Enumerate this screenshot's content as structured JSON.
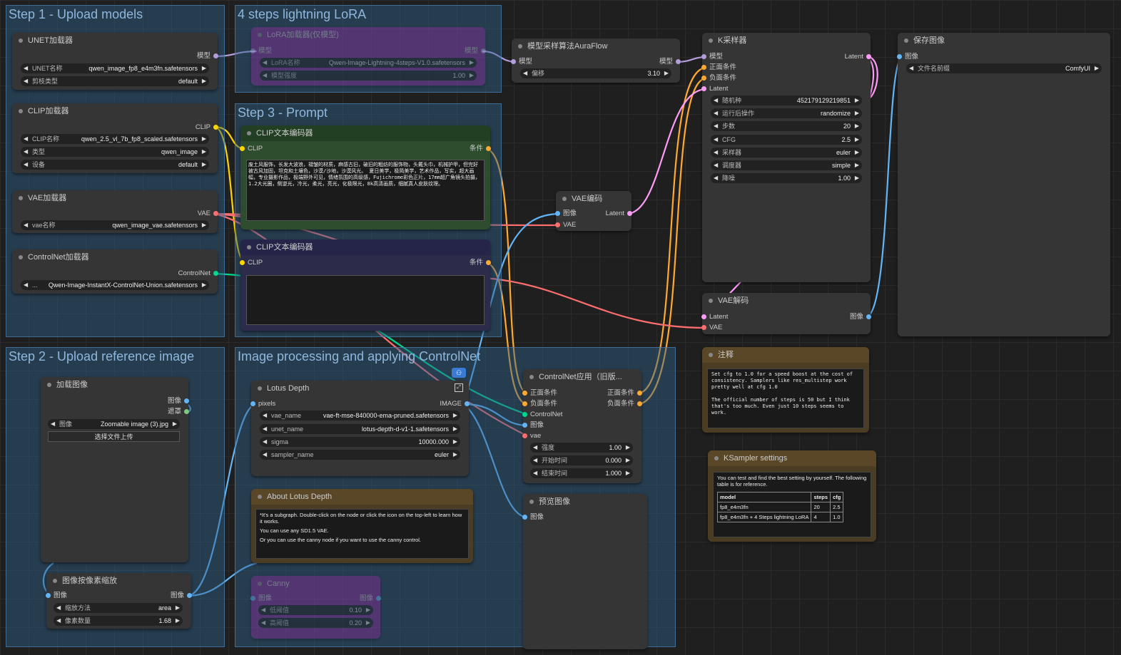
{
  "groups": {
    "g1": "Step 1 - Upload models",
    "g2": "4 steps lightning LoRA",
    "g3": "Step 3 - Prompt",
    "g4": "Step 2 - Upload reference image",
    "g5": "Image processing and applying ControlNet"
  },
  "unet": {
    "title": "UNET加载器",
    "out": "模型",
    "w1l": "UNET名称",
    "w1v": "qwen_image_fp8_e4m3fn.safetensors",
    "w2l": "剪枝类型",
    "w2v": "default"
  },
  "clip": {
    "title": "CLIP加载器",
    "out": "CLIP",
    "w1l": "CLIP名称",
    "w1v": "qwen_2.5_vl_7b_fp8_scaled.safetensors",
    "w2l": "类型",
    "w2v": "qwen_image",
    "w3l": "设备",
    "w3v": "default"
  },
  "vae": {
    "title": "VAE加载器",
    "out": "VAE",
    "w1l": "vae名称",
    "w1v": "qwen_image_vae.safetensors"
  },
  "cnl": {
    "title": "ControlNet加载器",
    "out": "ControlNet",
    "w1l": "...",
    "w1v": "Qwen-Image-InstantX-ControlNet-Union.safetensors"
  },
  "lora": {
    "title": "LoRA加载器(仅模型)",
    "in": "模型",
    "out": "模型",
    "w1l": "LoRA名称",
    "w1v": "Qwen-Image-Lightning-4steps-V1.0.safetensors",
    "w2l": "模型强度",
    "w2v": "1.00"
  },
  "aura": {
    "title": "模型采样算法AuraFlow",
    "in": "模型",
    "out": "模型",
    "w1l": "偏移",
    "w1v": "3.10"
  },
  "pos": {
    "title": "CLIP文本编码器",
    "in": "CLIP",
    "out": "条件",
    "text": "废土风服饰，长发大波浪，褶皱的材质，麻感古旧，破旧的粗纺的服饰物，头戴头巾，机械护甲，但完好被古风加固，坦克和土壤色，沙漠/沙地，沙漠风光。 夏日美学，极简美学，艺术作品，写实，超大画幅，专业摄影作品，极端野外可见，情绪氛围的高级感，Fujichrome彩色正片，17mm超广角镜头拍摄，1.2大光圈，侧逆光，冷光，柔光，亮光，化极限光，8k高清画质，细腻真人皮肤纹理。"
  },
  "neg": {
    "title": "CLIP文本编码器",
    "in": "CLIP",
    "out": "条件"
  },
  "vaeenc": {
    "title": "VAE编码",
    "in1": "图像",
    "in2": "VAE",
    "out": "Latent"
  },
  "ks": {
    "title": "K采样器",
    "in1": "模型",
    "in2": "正面条件",
    "in3": "负面条件",
    "in4": "Latent",
    "out": "Latent",
    "w": [
      [
        "随机种",
        "452179129219851"
      ],
      [
        "运行后操作",
        "randomize"
      ],
      [
        "步数",
        "20"
      ],
      [
        "CFG",
        "2.5"
      ],
      [
        "采样器",
        "euler"
      ],
      [
        "调度器",
        "simple"
      ],
      [
        "降噪",
        "1.00"
      ]
    ]
  },
  "save": {
    "title": "保存图像",
    "in": "图像",
    "w1l": "文件名前缀",
    "w1v": "ComfyUI"
  },
  "vaedec": {
    "title": "VAE解码",
    "in1": "Latent",
    "in2": "VAE",
    "out": "图像"
  },
  "note1": {
    "title": "注释",
    "text": "Set cfg to 1.0 for a speed boost at the cost of consistency. Samplers like res_multistep work pretty well at cfg 1.0\n\nThe official number of steps is 50 but I think that's too much. Even just 10 steps seems to work."
  },
  "note2": {
    "title": "KSampler settings",
    "text": "You can test and find the best setting by yourself. The following table is for reference.",
    "headers": [
      "model",
      "steps",
      "cfg"
    ],
    "rows": [
      [
        "fp8_e4m3fn",
        "20",
        "2.5"
      ],
      [
        "fp8_e4m3fn + 4 Steps lightning LoRA",
        "4",
        "1.0"
      ]
    ]
  },
  "loadimg": {
    "title": "加载图像",
    "out1": "图像",
    "out2": "遮罩",
    "w1l": "图像",
    "w1v": "Zoomable image (3).jpg",
    "button": "选择文件上传"
  },
  "scale": {
    "title": "图像按像素缩放",
    "in": "图像",
    "out": "图像",
    "w1l": "缩放方法",
    "w1v": "area",
    "w2l": "像素数量",
    "w2v": "1.68"
  },
  "lotus": {
    "title": "Lotus Depth",
    "in": "pixels",
    "out": "IMAGE",
    "w": [
      [
        "vae_name",
        "vae-ft-mse-840000-ema-pruned.safetensors"
      ],
      [
        "unet_name",
        "lotus-depth-d-v1-1.safetensors"
      ],
      [
        "sigma",
        "10000.000"
      ],
      [
        "sampler_name",
        "euler"
      ]
    ]
  },
  "about": {
    "title": "About Lotus Depth",
    "p1": "*It's a subgraph. Double-click on the node or click the icon on the top-left to learn how it works.",
    "p2": "You can use any SD1.5 VAE.",
    "p3": "Or you can use the canny node if you want to use the canny control."
  },
  "canny": {
    "title": "Canny",
    "in": "图像",
    "out": "图像",
    "w1l": "低阈值",
    "w1v": "0.10",
    "w2l": "高阈值",
    "w2v": "0.20"
  },
  "cnapply": {
    "title": "ControlNet应用（旧版...",
    "in1": "正面条件",
    "in2": "负面条件",
    "in3": "ControlNet",
    "in4": "图像",
    "in5": "vae",
    "out1": "正面条件",
    "out2": "负面条件",
    "w": [
      [
        "强度",
        "1.00"
      ],
      [
        "开始时间",
        "0.000"
      ],
      [
        "结束时间",
        "1.000"
      ]
    ]
  },
  "preview": {
    "title": "预览图像",
    "in": "图像"
  },
  "colors": {
    "model": "#b39ddb",
    "clip": "#ffd500",
    "vae": "#ff6e6e",
    "cond": "#ffa931",
    "latent": "#ff9cf9",
    "image": "#64b5f6",
    "cnet": "#00d78d"
  }
}
